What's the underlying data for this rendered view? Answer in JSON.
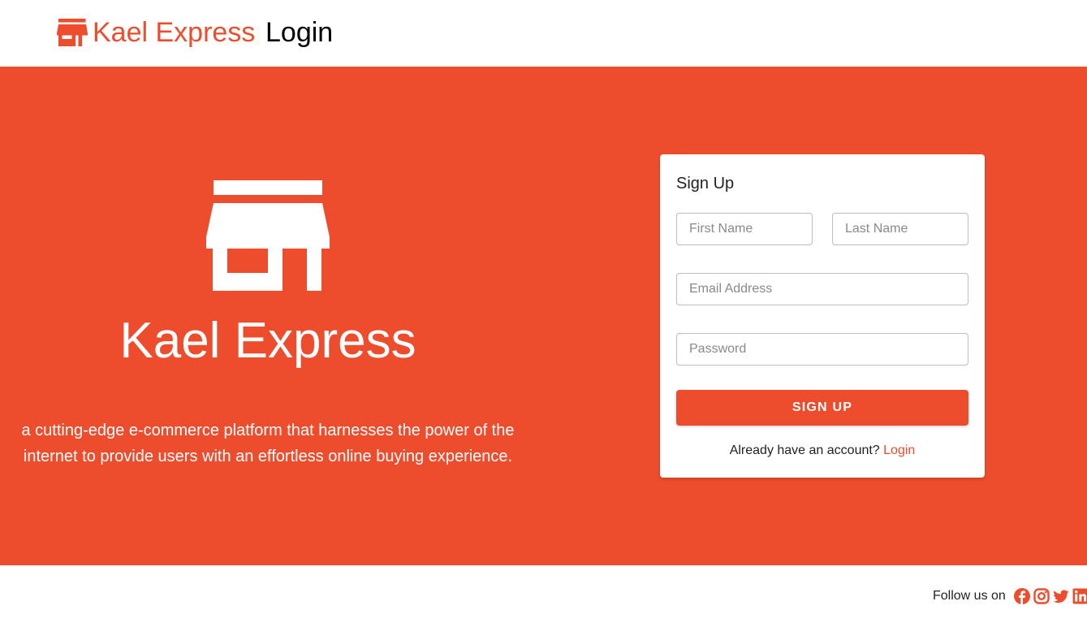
{
  "header": {
    "brand_name": "Kael Express",
    "page_title": "Login",
    "brand_icon": "storefront-icon"
  },
  "hero": {
    "icon": "storefront-icon",
    "title": "Kael Express",
    "description": "a cutting-edge e-commerce platform that harnesses the power of the internet to provide users with an effortless online buying experience."
  },
  "signup_form": {
    "title": "Sign Up",
    "first_name": {
      "value": "",
      "placeholder": "First Name"
    },
    "last_name": {
      "value": "",
      "placeholder": "Last Name"
    },
    "email": {
      "value": "",
      "placeholder": "Email Address"
    },
    "password": {
      "value": "",
      "placeholder": "Password"
    },
    "submit_label": "SIGN UP",
    "already_text": "Already have an account?",
    "login_link": "Login"
  },
  "footer": {
    "follow_text": "Follow us on",
    "social_icons": [
      "facebook-icon",
      "instagram-icon",
      "twitter-icon",
      "linkedin-icon"
    ]
  },
  "colors": {
    "brand": "#ee4d2d",
    "text_dark": "#222222",
    "white": "#ffffff"
  }
}
